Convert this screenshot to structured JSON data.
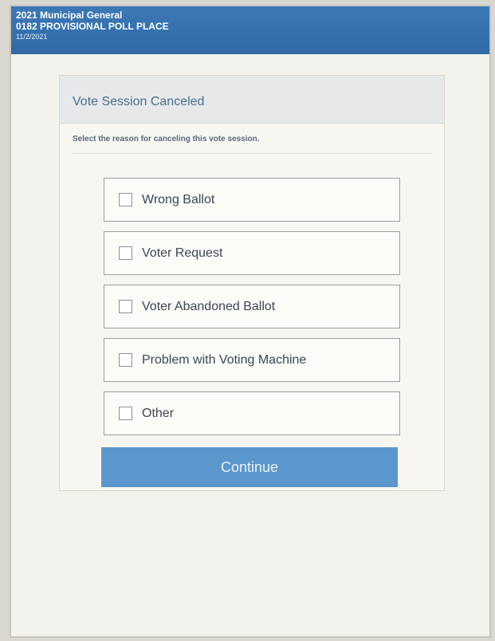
{
  "header": {
    "election": "2021 Municipal General",
    "poll_place": "0182 PROVISIONAL POLL PLACE",
    "date": "11/2/2021"
  },
  "dialog": {
    "title": "Vote Session Canceled",
    "instruction": "Select the reason for canceling this vote session.",
    "options": [
      {
        "label": "Wrong Ballot",
        "checked": false
      },
      {
        "label": "Voter Request",
        "checked": false
      },
      {
        "label": "Voter Abandoned Ballot",
        "checked": false
      },
      {
        "label": "Problem with Voting Machine",
        "checked": false
      },
      {
        "label": "Other",
        "checked": false
      }
    ],
    "continue_label": "Continue"
  },
  "colors": {
    "header_bg": "#3b78b6",
    "button_bg": "#5b97cc",
    "title_text": "#4a6e8e"
  }
}
